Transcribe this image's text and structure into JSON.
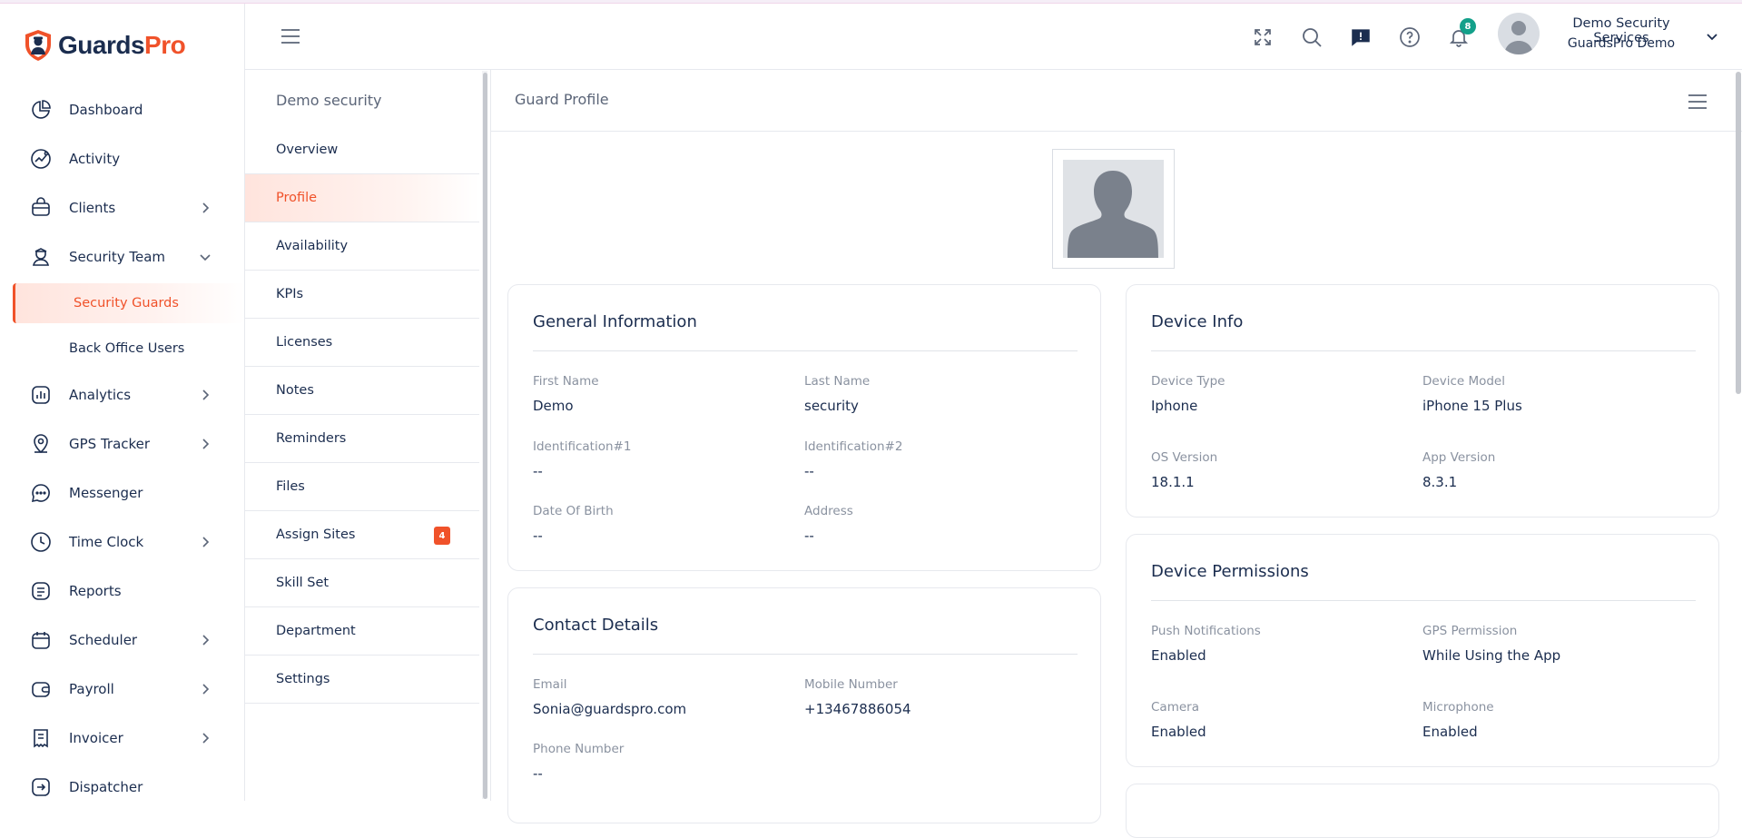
{
  "brand": {
    "name_part1": "Guards",
    "name_part2": "Pro",
    "accent": "#f0522a",
    "navy": "#1b2d4f"
  },
  "sidebar": {
    "items": [
      {
        "label": "Dashboard",
        "icon": "dashboard-icon",
        "has_chevron": false
      },
      {
        "label": "Activity",
        "icon": "activity-icon",
        "has_chevron": false
      },
      {
        "label": "Clients",
        "icon": "clients-icon",
        "has_chevron": true
      },
      {
        "label": "Security Team",
        "icon": "security-team-icon",
        "has_chevron": true,
        "expanded": true
      },
      {
        "label": "Analytics",
        "icon": "analytics-icon",
        "has_chevron": true
      },
      {
        "label": "GPS Tracker",
        "icon": "gps-icon",
        "has_chevron": true
      },
      {
        "label": "Messenger",
        "icon": "messenger-icon",
        "has_chevron": false
      },
      {
        "label": "Time Clock",
        "icon": "clock-icon",
        "has_chevron": true
      },
      {
        "label": "Reports",
        "icon": "reports-icon",
        "has_chevron": false
      },
      {
        "label": "Scheduler",
        "icon": "calendar-icon",
        "has_chevron": true
      },
      {
        "label": "Payroll",
        "icon": "wallet-icon",
        "has_chevron": true
      },
      {
        "label": "Invoicer",
        "icon": "invoice-icon",
        "has_chevron": true
      },
      {
        "label": "Dispatcher",
        "icon": "dispatcher-icon",
        "has_chevron": false
      }
    ],
    "security_team_sub": [
      {
        "label": "Security Guards",
        "active": true
      },
      {
        "label": "Back Office Users",
        "active": false
      }
    ]
  },
  "header": {
    "notification_count": "8",
    "user_name": "Demo Security Services",
    "user_org": "GuardsPro Demo"
  },
  "submenu": {
    "title": "Demo security",
    "items": [
      {
        "label": "Overview"
      },
      {
        "label": "Profile",
        "active": true
      },
      {
        "label": "Availability"
      },
      {
        "label": "KPIs"
      },
      {
        "label": "Licenses"
      },
      {
        "label": "Notes"
      },
      {
        "label": "Reminders"
      },
      {
        "label": "Files"
      },
      {
        "label": "Assign Sites",
        "badge": "4"
      },
      {
        "label": "Skill Set"
      },
      {
        "label": "Department"
      },
      {
        "label": "Settings"
      }
    ]
  },
  "main": {
    "title": "Guard Profile",
    "general": {
      "title": "General Information",
      "first_name_label": "First Name",
      "first_name": "Demo",
      "last_name_label": "Last Name",
      "last_name": "security",
      "id1_label": "Identification#1",
      "id1": "--",
      "id2_label": "Identification#2",
      "id2": "--",
      "dob_label": "Date Of Birth",
      "dob": "--",
      "address_label": "Address",
      "address": "--"
    },
    "contact": {
      "title": "Contact Details",
      "email_label": "Email",
      "email": "Sonia@guardspro.com",
      "mobile_label": "Mobile Number",
      "mobile": "+13467886054",
      "phone_label": "Phone Number",
      "phone": "--"
    },
    "device": {
      "title": "Device Info",
      "type_label": "Device Type",
      "type": "Iphone",
      "model_label": "Device Model",
      "model": "iPhone 15 Plus",
      "os_label": "OS Version",
      "os": "18.1.1",
      "app_label": "App Version",
      "app": "8.3.1"
    },
    "permissions": {
      "title": "Device Permissions",
      "push_label": "Push Notifications",
      "push": "Enabled",
      "gps_label": "GPS Permission",
      "gps": "While Using the App",
      "camera_label": "Camera",
      "camera": "Enabled",
      "mic_label": "Microphone",
      "mic": "Enabled"
    }
  }
}
